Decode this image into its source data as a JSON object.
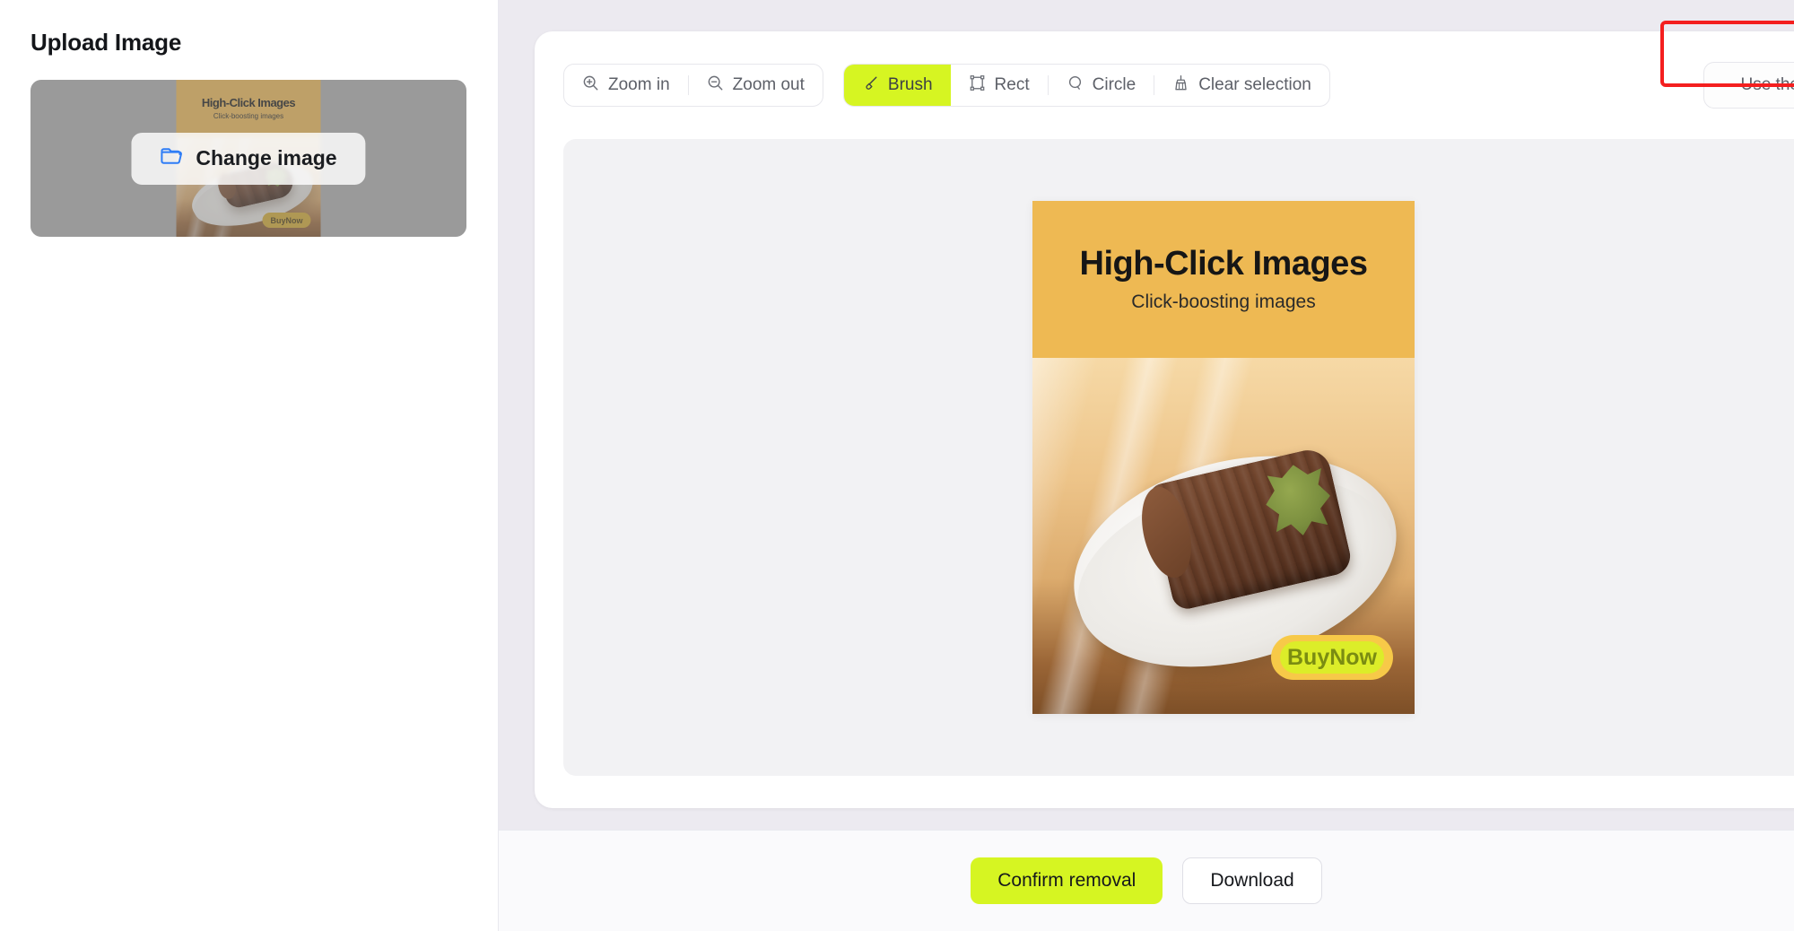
{
  "sidebar": {
    "title": "Upload Image",
    "change_image_label": "Change image",
    "folder_icon": "folder-open-icon"
  },
  "toolbar": {
    "zoom_in": {
      "label": "Zoom in",
      "icon": "zoom-in-icon"
    },
    "zoom_out": {
      "label": "Zoom out",
      "icon": "zoom-out-icon"
    },
    "brush": {
      "label": "Brush",
      "icon": "brush-icon",
      "active": true
    },
    "rect": {
      "label": "Rect",
      "icon": "rectangle-select-icon",
      "active": false
    },
    "circle": {
      "label": "Circle",
      "icon": "circle-select-icon",
      "active": false
    },
    "clear_selection": {
      "label": "Clear selection",
      "icon": "broom-icon",
      "active": false
    },
    "use_original": {
      "label": "Use the original image"
    },
    "active_color": "#d6f522",
    "highlight_color": "#f41f1f"
  },
  "creative": {
    "title": "High-Click Images",
    "subtitle": "Click-boosting images",
    "buy_label": "BuyNow",
    "header_color": "#eeb953",
    "buy_color": "#f7c948"
  },
  "footer": {
    "confirm_label": "Confirm removal",
    "download_label": "Download"
  }
}
